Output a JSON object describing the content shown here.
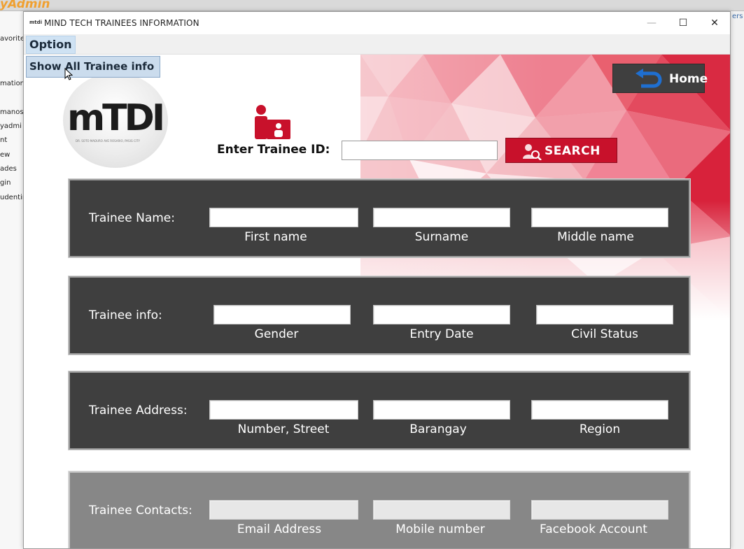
{
  "background_app": {
    "logo_text": "yAdmin",
    "sidebar_items": [
      "avorite",
      "mation_",
      "manos",
      "yadmi",
      "nt",
      "ew",
      "ades",
      "gin",
      "udentin"
    ],
    "right_text": "ers"
  },
  "window": {
    "title": "MIND TECH TRAINEES INFORMATION",
    "icon_text": "mtdi",
    "minimize_glyph": "—",
    "maximize_glyph": "☐",
    "close_glyph": "✕"
  },
  "menu": {
    "option_label": "Option",
    "dropdown_item": "Show All Trainee info"
  },
  "header": {
    "home_label": "Home",
    "logo_letters": "mTDI",
    "logo_subtext": "DR. SOTO MADURO AVE ROSARIO, PASIG CITY",
    "id_label": "Enter Trainee ID:",
    "id_value": "",
    "search_label": "SEARCH"
  },
  "panels": [
    {
      "label": "Trainee Name:",
      "fields": [
        {
          "caption": "First name",
          "value": ""
        },
        {
          "caption": "Surname",
          "value": ""
        },
        {
          "caption": "Middle name",
          "value": ""
        }
      ]
    },
    {
      "label": "Trainee info:",
      "fields": [
        {
          "caption": "Gender",
          "value": ""
        },
        {
          "caption": "Entry Date",
          "value": ""
        },
        {
          "caption": "Civil Status",
          "value": ""
        }
      ]
    },
    {
      "label": "Trainee Address:",
      "fields": [
        {
          "caption": "Number, Street",
          "value": ""
        },
        {
          "caption": "Barangay",
          "value": ""
        },
        {
          "caption": "Region",
          "value": ""
        }
      ]
    },
    {
      "label": "Trainee Contacts:",
      "fields": [
        {
          "caption": "Email Address",
          "value": ""
        },
        {
          "caption": "Mobile number",
          "value": ""
        },
        {
          "caption": "Facebook Account",
          "value": ""
        }
      ]
    }
  ],
  "colors": {
    "panel_bg": "#3f3f3f",
    "accent_red": "#c8112b",
    "home_arrow": "#1f6fd0"
  }
}
